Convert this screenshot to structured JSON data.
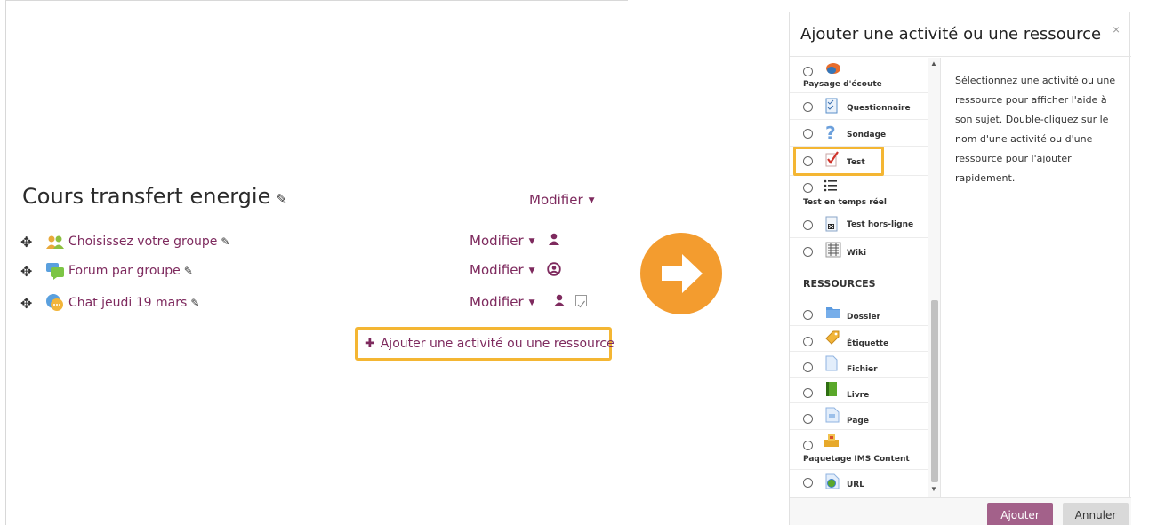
{
  "section": {
    "title": "Cours transfert energie",
    "modifier_label": "Modifier"
  },
  "activities": [
    {
      "name": "Choisissez votre groupe",
      "modifier_label": "Modifier",
      "icon": "group-icon",
      "role_icon": "user-icon"
    },
    {
      "name": "Forum par groupe",
      "modifier_label": "Modifier",
      "icon": "forum-icon",
      "role_icon": "user-circle-icon"
    },
    {
      "name": "Chat jeudi 19 mars",
      "modifier_label": "Modifier",
      "icon": "chat-icon",
      "role_icon": "user-icon",
      "completion_icon": "checkbox-icon"
    }
  ],
  "add_activity": {
    "label": "Ajouter une activité ou une ressource"
  },
  "modal": {
    "title": "Ajouter une activité ou une ressource",
    "close_glyph": "×",
    "help_text": "Sélectionnez une activité ou une ressource pour afficher l'aide à son sujet. Double-cliquez sur le nom d'une activité ou d'une ressource pour l'ajouter rapidement.",
    "activities": [
      {
        "label": "Paysage d'écoute",
        "icon": "soundscape-icon"
      },
      {
        "label": "Questionnaire",
        "icon": "questionnaire-icon"
      },
      {
        "label": "Sondage",
        "icon": "survey-question-icon"
      },
      {
        "label": "Test",
        "icon": "quiz-check-icon",
        "highlighted": true
      },
      {
        "label": "Test en temps réel",
        "icon": "list-icon"
      },
      {
        "label": "Test hors-ligne",
        "icon": "offline-test-icon"
      },
      {
        "label": "Wiki",
        "icon": "wiki-icon"
      }
    ],
    "resources_heading": "RESSOURCES",
    "resources": [
      {
        "label": "Dossier",
        "icon": "folder-icon"
      },
      {
        "label": "Étiquette",
        "icon": "label-tag-icon"
      },
      {
        "label": "Fichier",
        "icon": "file-icon"
      },
      {
        "label": "Livre",
        "icon": "book-icon"
      },
      {
        "label": "Page",
        "icon": "page-icon"
      },
      {
        "label": "Paquetage IMS Content",
        "icon": "ims-package-icon"
      },
      {
        "label": "URL",
        "icon": "url-globe-icon"
      }
    ],
    "add_button": "Ajouter",
    "cancel_button": "Annuler"
  },
  "colors": {
    "link": "#7e2a5e",
    "highlight": "#f4b633",
    "arrow": "#f39c2f",
    "primary_button": "#a3618a"
  }
}
